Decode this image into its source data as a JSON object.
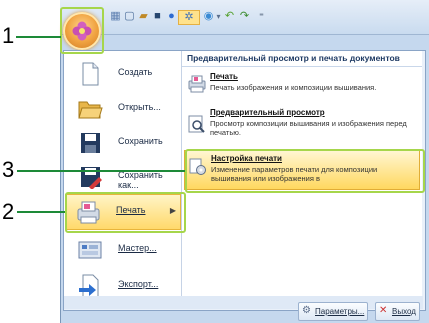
{
  "callouts": [
    "1",
    "2",
    "3"
  ],
  "menu": {
    "items": [
      {
        "label": "Создать",
        "icon": "new-document-icon"
      },
      {
        "label": "Открыть...",
        "icon": "folder-open-icon"
      },
      {
        "label": "Сохранить",
        "icon": "save-icon"
      },
      {
        "label": "Сохранить как...",
        "icon": "save-as-icon"
      },
      {
        "label": "Печать",
        "icon": "print-icon",
        "highlighted": true,
        "submenu_arrow": "▶"
      },
      {
        "label": "Мастер...",
        "icon": "wizard-icon"
      },
      {
        "label": "Экспорт...",
        "icon": "export-icon"
      }
    ]
  },
  "submenu": {
    "header": "Предварительный просмотр и печать документов",
    "items": [
      {
        "title": "Печать",
        "desc": "Печать изображения и композиции вышивания.",
        "icon": "print-icon"
      },
      {
        "title": "Предварительный просмотр",
        "desc": "Просмотр композиции вышивания и изображения перед печатью.",
        "icon": "preview-magnifier-icon"
      },
      {
        "title": "Настройка печати",
        "desc": "Изменение параметров печати для композиции вышивания или изображения в",
        "icon": "print-setup-icon",
        "highlighted": true
      }
    ]
  },
  "bottom": {
    "params_label": "Параметры...",
    "exit_label": "Выход"
  },
  "colors": {
    "callout_line": "#1d8a38",
    "callout_box": "#a6d64b",
    "highlight": "#ffd96b"
  }
}
